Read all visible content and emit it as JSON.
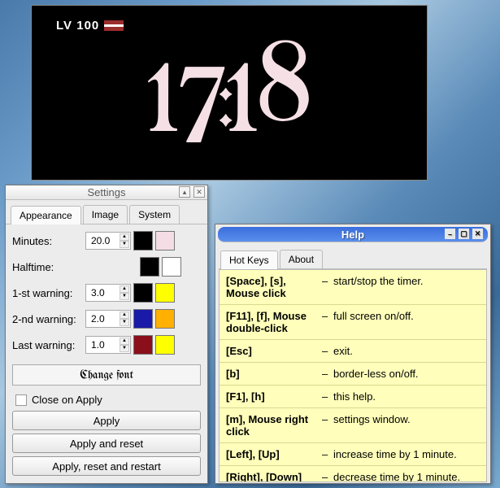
{
  "clock": {
    "logo": "LV 100",
    "time": "17:18"
  },
  "settings": {
    "title": "Settings",
    "tabs": [
      "Appearance",
      "Image",
      "System"
    ],
    "minutes": {
      "label": "Minutes:",
      "value": "20.0"
    },
    "halftime": {
      "label": "Halftime:"
    },
    "warn1": {
      "label": "1-st warning:",
      "value": "3.0"
    },
    "warn2": {
      "label": "2-nd warning:",
      "value": "2.0"
    },
    "warnlast": {
      "label": "Last warning:",
      "value": "1.0"
    },
    "colors": {
      "minutes_a": "#000000",
      "minutes_b": "#f5dde5",
      "halftime_a": "#000000",
      "halftime_b": "#ffffff",
      "warn1_a": "#000000",
      "warn1_b": "#ffff00",
      "warn2_a": "#1a1aa8",
      "warn2_b": "#ffb000",
      "warnlast_a": "#8b0f1a",
      "warnlast_b": "#ffff00"
    },
    "change_font": "Change font",
    "close_on_apply": "Close on Apply",
    "apply": "Apply",
    "apply_reset": "Apply and reset",
    "apply_reset_restart": "Apply, reset and restart"
  },
  "help": {
    "title": "Help",
    "tabs": [
      "Hot Keys",
      "About"
    ],
    "rows": [
      {
        "keys": "[Space], [s], Mouse click",
        "desc": "start/stop the timer."
      },
      {
        "keys": "[F11], [f], Mouse double-click",
        "desc": "full screen on/off."
      },
      {
        "keys": "[Esc]",
        "desc": "exit."
      },
      {
        "keys": "[b]",
        "desc": "border-less on/off."
      },
      {
        "keys": "[F1], [h]",
        "desc": "this help."
      },
      {
        "keys": "[m], Mouse right click",
        "desc": "settings window."
      },
      {
        "keys": "[Left], [Up]",
        "desc": "increase time by 1 minute."
      },
      {
        "keys": "[Right], [Down]",
        "desc": "decrease time by 1 minute."
      }
    ]
  }
}
